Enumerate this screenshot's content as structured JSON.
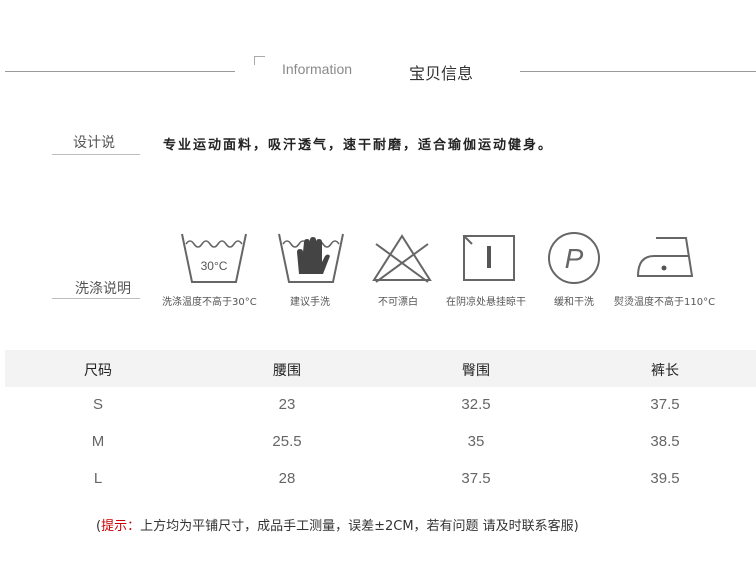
{
  "header": {
    "en_title": "Information",
    "cn_title": "宝贝信息"
  },
  "design": {
    "label": "设计说",
    "text": "专业运动面料，吸汗透气，速干耐磨，适合瑜伽运动健身。"
  },
  "care": {
    "label": "洗涤说明",
    "items": [
      {
        "icon": "wash-30-icon",
        "icon_text": "30°C",
        "label": "洗涤温度不高于30°C"
      },
      {
        "icon": "hand-wash-icon",
        "label": "建议手洗"
      },
      {
        "icon": "no-bleach-icon",
        "label": "不可漂白"
      },
      {
        "icon": "shade-dry-icon",
        "label": "在阴凉处悬挂晾干"
      },
      {
        "icon": "dry-clean-p-icon",
        "icon_text": "P",
        "label": "缓和干洗"
      },
      {
        "icon": "iron-icon",
        "label": "熨烫温度不高于110°C"
      }
    ]
  },
  "size_table": {
    "headers": [
      "尺码",
      "腰围",
      "臀围",
      "裤长"
    ],
    "rows": [
      [
        "S",
        "23",
        "32.5",
        "37.5"
      ],
      [
        "M",
        "25.5",
        "35",
        "38.5"
      ],
      [
        "L",
        "28",
        "37.5",
        "39.5"
      ]
    ]
  },
  "note": {
    "open": "(",
    "prefix": "提示：",
    "text": "上方均为平铺尺寸，成品手工测量，误差±2CM，若有问题 请及时联系客服)"
  }
}
